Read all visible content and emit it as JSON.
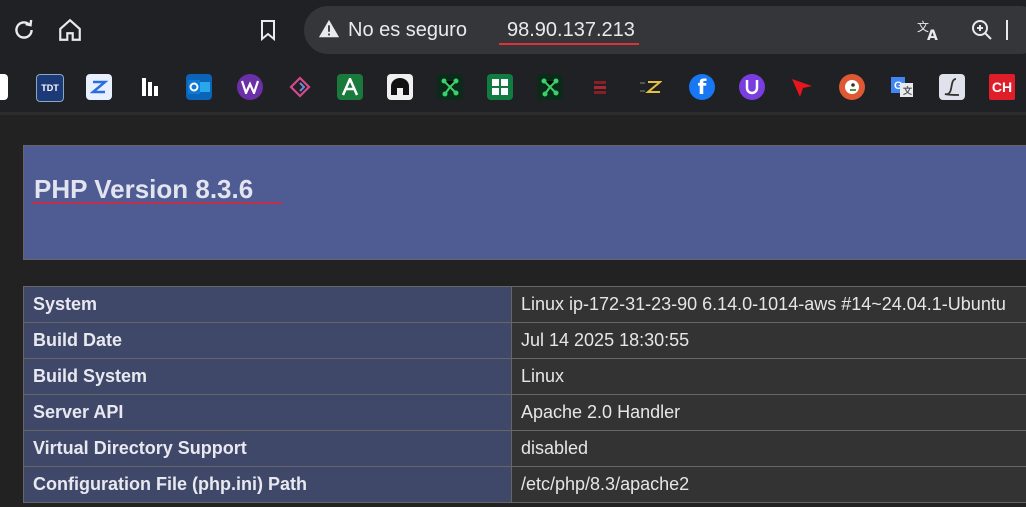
{
  "toolbar": {
    "reload_icon": "reload-icon",
    "home_icon": "home-icon",
    "bookmark_icon": "bookmark-star-icon"
  },
  "omnibox": {
    "security_label": "No es seguro",
    "url": "98.90.137.213",
    "warning_icon": "warning-triangle-icon",
    "translate_icon": "translate-icon",
    "zoom_icon": "zoom-in-icon"
  },
  "bookmarks": {
    "tdt_label": "TDT",
    "ch_label": "CH"
  },
  "php": {
    "title": "PHP Version 8.3.6",
    "rows": [
      {
        "key": "System",
        "value": "Linux ip-172-31-23-90 6.14.0-1014-aws #14~24.04.1-Ubuntu"
      },
      {
        "key": "Build Date",
        "value": "Jul 14 2025 18:30:55"
      },
      {
        "key": "Build System",
        "value": "Linux"
      },
      {
        "key": "Server API",
        "value": "Apache 2.0 Handler"
      },
      {
        "key": "Virtual Directory Support",
        "value": "disabled"
      },
      {
        "key": "Configuration File (php.ini) Path",
        "value": "/etc/php/8.3/apache2"
      }
    ]
  },
  "colors": {
    "header_bg": "#4f5b93",
    "key_bg": "#3f4868",
    "value_bg": "#333333",
    "url_underline": "#e0303a"
  }
}
